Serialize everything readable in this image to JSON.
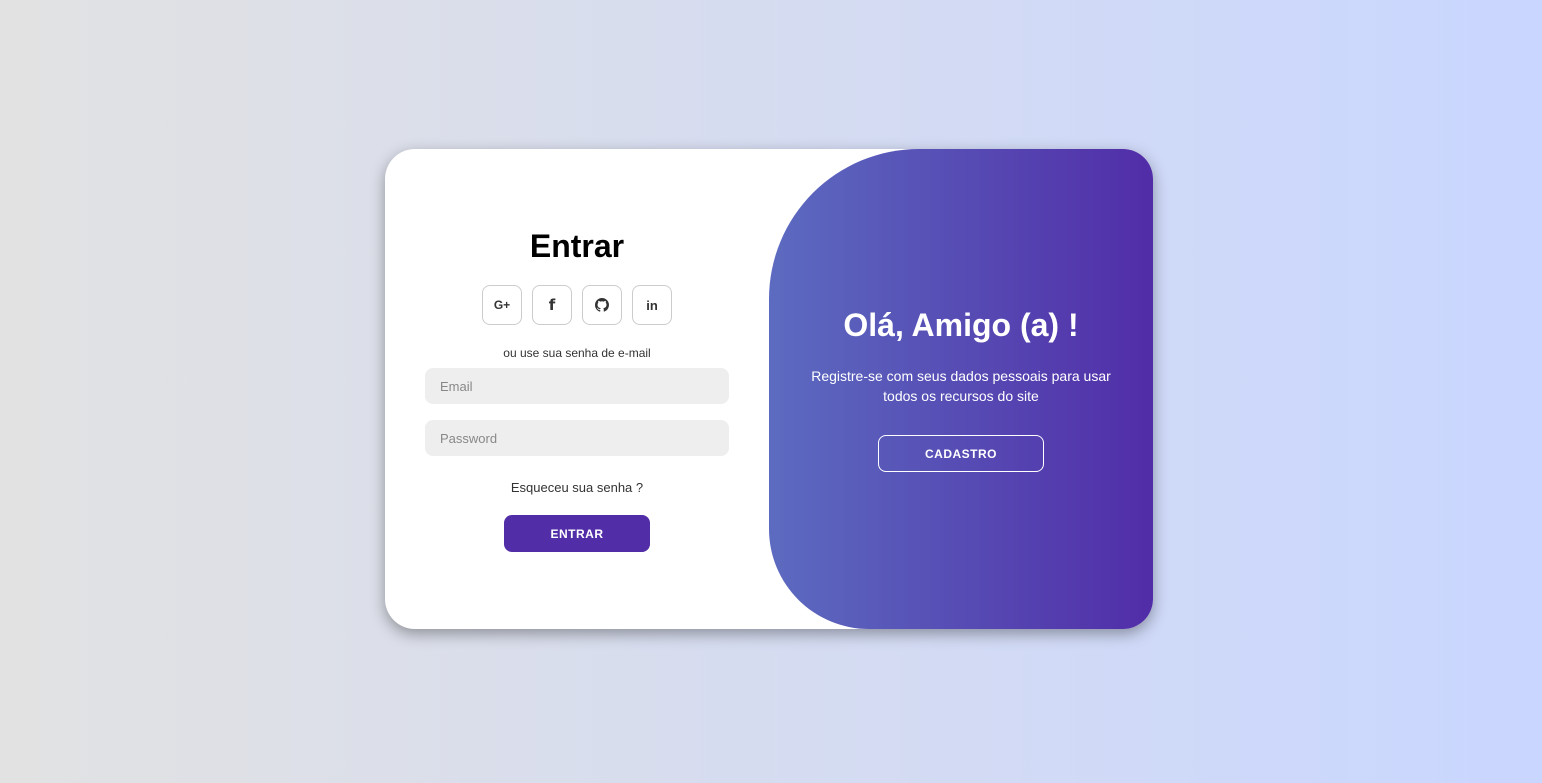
{
  "login": {
    "title": "Entrar",
    "social": [
      {
        "icon": "google-plus-icon",
        "glyph": "G+"
      },
      {
        "icon": "facebook-icon",
        "glyph": "f"
      },
      {
        "icon": "github-icon",
        "glyph": ""
      },
      {
        "icon": "linkedin-icon",
        "glyph": "in"
      }
    ],
    "alt_text": "ou use sua senha de e-mail",
    "email_placeholder": "Email",
    "password_placeholder": "Password",
    "forgot_text": "Esqueceu sua senha ?",
    "submit_label": "ENTRAR"
  },
  "welcome": {
    "title": "Olá, Amigo (a) !",
    "text": "Registre-se com seus dados pessoais para usar todos os recursos do site",
    "register_label": "CADASTRO"
  },
  "colors": {
    "primary": "#512da8",
    "gradient_start": "#5c6bc0",
    "background_left": "#e2e2e2",
    "background_right": "#c9d6ff"
  }
}
